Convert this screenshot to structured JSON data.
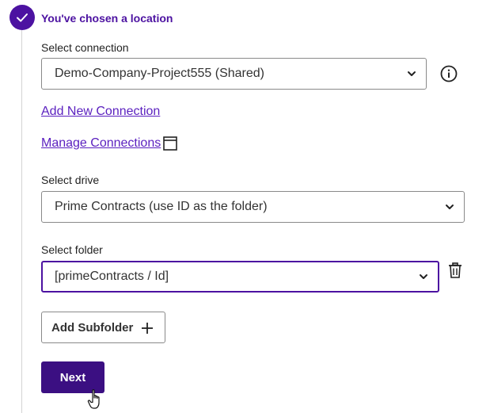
{
  "step": {
    "title": "You've chosen a location"
  },
  "connection": {
    "label": "Select connection",
    "value": "Demo-Company-Project555 (Shared)",
    "add_link": "Add New Connection",
    "manage_link": "Manage Connections"
  },
  "drive": {
    "label": "Select drive",
    "value": "Prime Contracts (use ID as the folder)"
  },
  "folder": {
    "label": "Select folder",
    "value": "[primeContracts / Id]"
  },
  "buttons": {
    "add_subfolder": "Add Subfolder",
    "next": "Next"
  },
  "icons": [
    "check-icon",
    "info-icon",
    "external-window-icon",
    "chevron-down-icon",
    "trash-icon",
    "plus-icon",
    "hand-cursor-icon"
  ],
  "colors": {
    "accent": "#4c12a1",
    "primary_button": "#3b0f82",
    "link": "#5a1fbf"
  }
}
